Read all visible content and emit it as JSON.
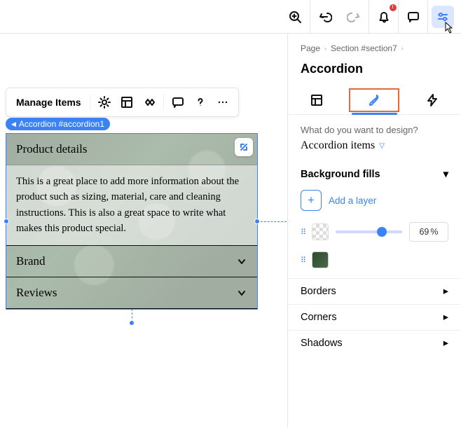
{
  "topbar": {
    "icons": {
      "zoom": "zoom-in",
      "undo": "undo",
      "redo": "redo",
      "notif": "bell",
      "comment": "chat",
      "tweak": "sliders"
    }
  },
  "floatingToolbar": {
    "manage": "Manage Items"
  },
  "tagChip": "Accordion #accordion1",
  "accordion": {
    "items": [
      {
        "title": "Product details",
        "body": "This is a great place to add more information about the product such as sizing, material, care and cleaning instructions. This is also a great space to write what makes this product special.",
        "open": true
      },
      {
        "title": "Brand",
        "open": false
      },
      {
        "title": "Reviews",
        "open": false
      }
    ]
  },
  "panel": {
    "crumbs": [
      "Page",
      "Section #section7"
    ],
    "title": "Accordion",
    "prompt": "What do you want to design?",
    "selector": "Accordion items",
    "sections": {
      "bgfills": "Background fills",
      "addLayer": "Add a layer",
      "opacityPct": "69",
      "borders": "Borders",
      "corners": "Corners",
      "shadows": "Shadows"
    }
  }
}
